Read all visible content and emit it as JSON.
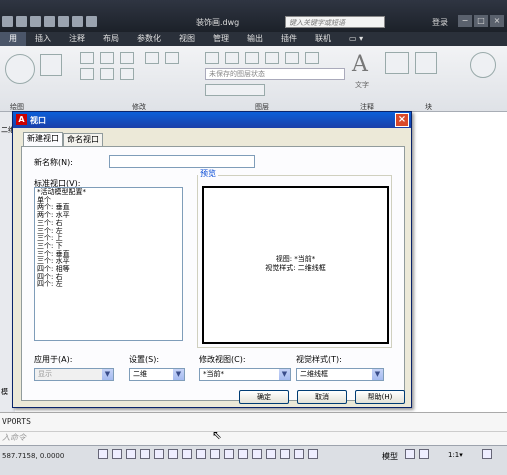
{
  "titlebar": {
    "file_title": "装饰画.dwg",
    "search_placeholder": "键入关键字或短语",
    "login": "登录",
    "min": "−",
    "max": "□",
    "close": "×"
  },
  "ribbon": {
    "tabs": [
      "用",
      "插入",
      "注释",
      "布局",
      "参数化",
      "视图",
      "管理",
      "输出",
      "插件",
      "联机",
      "▭ ▾"
    ],
    "active_tab_index": 0,
    "group_labels": [
      "绘图",
      "修改",
      "图层",
      "注释",
      "块"
    ],
    "layer_state_placeholder": "未保存的图层状态",
    "text_label": "文字"
  },
  "dialog": {
    "title": "视口",
    "icon_text": "A",
    "close": "×",
    "tabs": [
      "新建视口",
      "命名视口"
    ],
    "active_tab": 0,
    "new_name_label": "新名称(N):",
    "new_name_value": "",
    "standard_label": "标准视口(V):",
    "standard_list": [
      "*活动模型配置*",
      "单个",
      "两个: 垂直",
      "两个: 水平",
      "三个: 右",
      "三个: 左",
      "三个: 上",
      "三个: 下",
      "三个: 垂直",
      "三个: 水平",
      "四个: 相等",
      "四个: 右",
      "四个: 左"
    ],
    "preview_label": "预览",
    "preview_view": "视图: *当前*",
    "preview_style": "视觉样式: 二维线框",
    "apply_to_label": "应用于(A):",
    "apply_to_value": "显示",
    "setup_label": "设置(S):",
    "setup_value": "二维",
    "change_view_label": "修改视图(C):",
    "change_view_value": "*当前*",
    "visual_style_label": "视觉样式(T):",
    "visual_style_value": "二维线框",
    "ok": "确定",
    "cancel": "取消",
    "help": "帮助(H)"
  },
  "command": {
    "history": "VPORTS",
    "prompt": "入命令"
  },
  "status": {
    "coords": "587.7158, 0.0000",
    "model": "模型",
    "scale": "1:1▾"
  },
  "left_strip": {
    "top_text": "二维",
    "bottom_text": "模"
  }
}
